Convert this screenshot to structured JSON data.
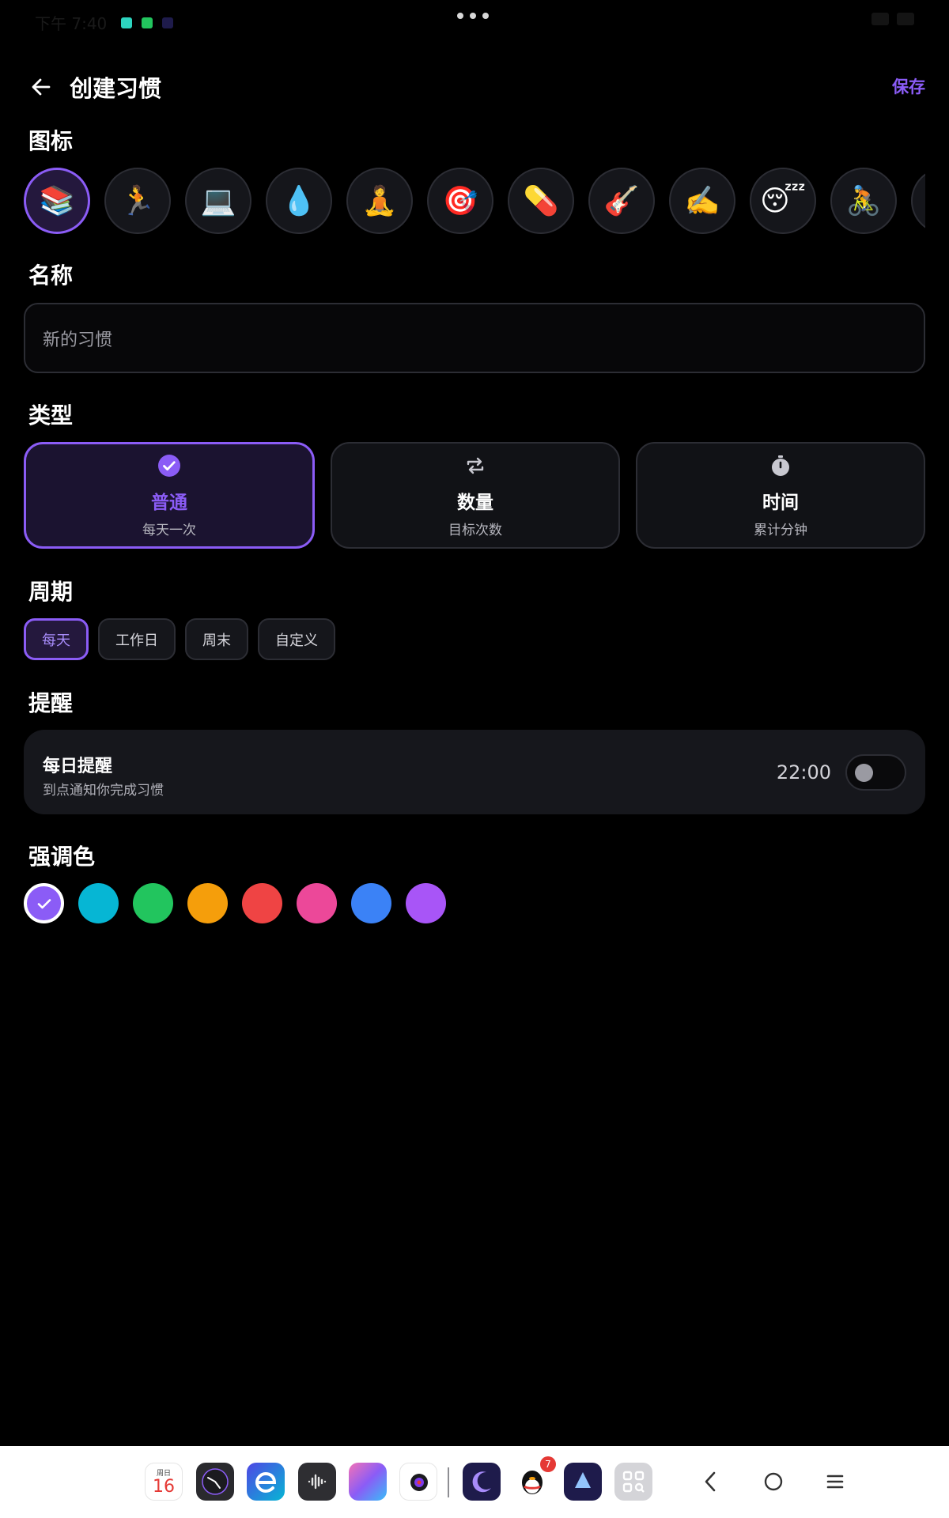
{
  "status_bar": {
    "time": "下午 7:40"
  },
  "header": {
    "title": "创建习惯",
    "save_label": "保存"
  },
  "sections": {
    "icon": "图标",
    "name": "名称",
    "type": "类型",
    "period": "周期",
    "reminder": "提醒",
    "accent": "强调色"
  },
  "icons": [
    {
      "name": "books-icon",
      "glyph": "📚",
      "selected": true
    },
    {
      "name": "running-icon",
      "glyph": "🏃",
      "selected": false
    },
    {
      "name": "laptop-icon",
      "glyph": "💻",
      "selected": false
    },
    {
      "name": "water-drop-icon",
      "glyph": "💧",
      "selected": false
    },
    {
      "name": "meditation-icon",
      "glyph": "🧘",
      "selected": false
    },
    {
      "name": "target-icon",
      "glyph": "🎯",
      "selected": false
    },
    {
      "name": "pill-icon",
      "glyph": "💊",
      "selected": false
    },
    {
      "name": "guitar-icon",
      "glyph": "🎸",
      "selected": false
    },
    {
      "name": "writing-icon",
      "glyph": "✍️",
      "selected": false
    },
    {
      "name": "sleeping-face-icon",
      "glyph": "😴",
      "selected": false
    },
    {
      "name": "cycling-icon",
      "glyph": "🚴",
      "selected": false
    },
    {
      "name": "more-icon",
      "glyph": "",
      "selected": false
    }
  ],
  "name_input": {
    "placeholder": "新的习惯"
  },
  "types": [
    {
      "id": "normal",
      "title": "普通",
      "subtitle": "每天一次",
      "selected": true
    },
    {
      "id": "count",
      "title": "数量",
      "subtitle": "目标次数",
      "selected": false
    },
    {
      "id": "timer",
      "title": "时间",
      "subtitle": "累计分钟",
      "selected": false
    }
  ],
  "periods": [
    {
      "label": "每天",
      "selected": true
    },
    {
      "label": "工作日",
      "selected": false
    },
    {
      "label": "周末",
      "selected": false
    },
    {
      "label": "自定义",
      "selected": false
    }
  ],
  "reminder": {
    "title": "每日提醒",
    "subtitle": "到点通知你完成习惯",
    "time": "22:00",
    "enabled": false
  },
  "accent_colors": [
    {
      "hex": "#8b5cf6",
      "selected": true
    },
    {
      "hex": "#06b6d4",
      "selected": false
    },
    {
      "hex": "#22c55e",
      "selected": false
    },
    {
      "hex": "#f59e0b",
      "selected": false
    },
    {
      "hex": "#ef4444",
      "selected": false
    },
    {
      "hex": "#ec4899",
      "selected": false
    },
    {
      "hex": "#3b82f6",
      "selected": false
    },
    {
      "hex": "#a855f7",
      "selected": false
    }
  ],
  "dock": {
    "calendar": {
      "weekday": "周日",
      "day": "16"
    },
    "qq_badge": "7"
  }
}
